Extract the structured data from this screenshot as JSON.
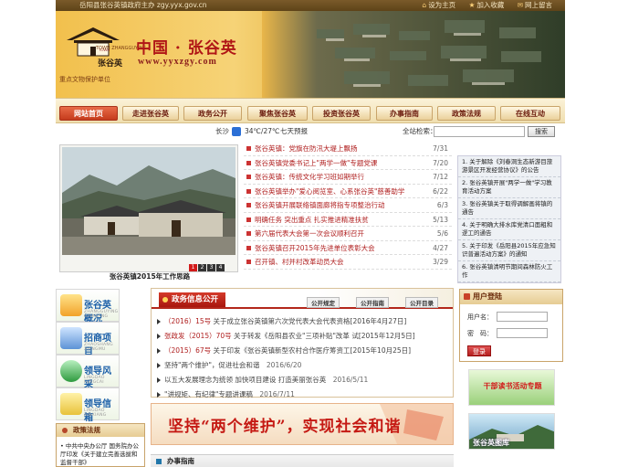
{
  "topbar": {
    "sponsor": "岳阳县张谷英镇政府主办 zgy.yyx.gov.cn",
    "links": [
      "设为主页",
      "加入收藏",
      "网上留言"
    ]
  },
  "banner": {
    "logo_cn": "张谷英",
    "logo_en": "TOWN ZHANGGUYING",
    "title": "中国 · 张谷英",
    "url": "www.yyxzgy.com",
    "slogan": "重点文物保护单位"
  },
  "nav": [
    "网站首页",
    "走进张谷英",
    "政务公开",
    "聚焦张谷英",
    "投资张谷英",
    "办事指南",
    "政策法规",
    "在线互动"
  ],
  "weather": {
    "city": "长沙",
    "temp": "34℃/27℃",
    "cond": "七天预报"
  },
  "search": {
    "label": "全站检索：",
    "button": "搜索"
  },
  "hero": {
    "caption": "张谷英镇2015年工作思路",
    "pages": [
      "1",
      "2",
      "3",
      "4"
    ]
  },
  "news": [
    {
      "title": "张谷英镇：党旗在防汛大堤上飘扬",
      "date": "7/31"
    },
    {
      "title": "张谷英镇党委书记上\"两学一做\"专题党课",
      "date": "7/20"
    },
    {
      "title": "张谷英镇：传统文化学习班如期举行",
      "date": "7/12"
    },
    {
      "title": "张谷英镇举办\"爱心阅览室、心系张谷英\"慈善助学",
      "date": "6/22"
    },
    {
      "title": "张谷英镇开展联络镇面廊将指专项整治行动",
      "date": "6/3"
    },
    {
      "title": "明确任务  突出重点  扎实推进精准扶贫",
      "date": "5/13"
    },
    {
      "title": "第六届代表大会第一次会议顺利召开",
      "date": "5/6"
    },
    {
      "title": "张谷英镇召开2015年先进单位表彰大会",
      "date": "4/27"
    },
    {
      "title": "召开镇、村并村改革动员大会",
      "date": "3/29"
    }
  ],
  "notices": [
    "1. 关于解除《刘春洞生态新游目旅游景区开发经营协议》的公告",
    "2. 张谷英镇开展\"两学一做\"学习教育活动方案",
    "3. 张谷英镇关于取得调解画将镇的通告",
    "4. 关于明确大排水库党清口面粗和逻工的通告",
    "5. 关于印发《岳阳县2015年应急知识普遍活动方案》的通知",
    "6. 张谷英镇清明节期间森林防火工作"
  ],
  "left_blocks": [
    {
      "name": "张谷英概况",
      "py": "ZHANGGUYING GAIKUANG"
    },
    {
      "name": "招商项目",
      "py": "ZHAOSHANG XIANGMU"
    },
    {
      "name": "领导风采",
      "py": "LINGDAO FENGCAI"
    },
    {
      "name": "领导信箱",
      "py": "LINGDAO XINXIANG"
    }
  ],
  "rules": {
    "title": "政策法规",
    "item": "• 中共中央办公厅 国务院办公厅印发《关于建立完善选拔和监督干部》"
  },
  "gov": {
    "title": "政务信息公开",
    "tabs": [
      "公开规定",
      "公开指南",
      "公开目录"
    ],
    "docs": [
      {
        "prefix": "（2016）15号",
        "text": "关于成立张谷英镇第六次党代表大会代表资格[2016年4月27日]"
      },
      {
        "prefix": "张政发（2015）70号",
        "text": "关于转发《岳阳县农业\"三项补贴\"改革 试[2015年12月5日]"
      },
      {
        "prefix": "（2015）67号",
        "text": "关于印发《张谷英镇新型农村合作医疗筹资工[2015年10月25日]"
      }
    ],
    "articles": [
      {
        "text": "坚持\"两个维护\"，促进社会和谐",
        "date": "2016/6/20"
      },
      {
        "text": "以五大发展理念为统领 加快项目建设 打造美丽张谷英",
        "date": "2016/5/11"
      },
      {
        "text": "\"讲规矩、有纪律\"专题讲课稿",
        "date": "2016/7/11"
      }
    ]
  },
  "slogan_banner": "坚持“两个维护”，实现社会和谐",
  "guide": {
    "title": "办事指南"
  },
  "login": {
    "title": "用户登陆",
    "user_label": "用户名：",
    "pass_label": "密　码：",
    "button": "登录"
  },
  "promos": [
    {
      "title": "干部读书活动专题"
    },
    {
      "title": "张谷英图库"
    }
  ]
}
